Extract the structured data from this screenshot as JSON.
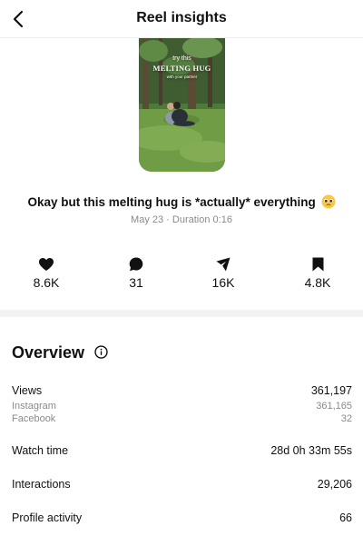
{
  "header": {
    "title": "Reel insights",
    "back_icon": "chevron-left-icon"
  },
  "reel": {
    "thumbnail_text": {
      "line1": "try this",
      "line2": "MELTING HUG",
      "line3": "with your partner"
    },
    "caption": "Okay but this melting hug is *actually* everything",
    "caption_emoji": "pleading-face-emoji",
    "meta": "May 23 · Duration 0:16"
  },
  "stats": [
    {
      "icon": "heart-icon",
      "value": "8.6K"
    },
    {
      "icon": "comment-icon",
      "value": "31"
    },
    {
      "icon": "send-icon",
      "value": "16K"
    },
    {
      "icon": "bookmark-icon",
      "value": "4.8K"
    }
  ],
  "overview": {
    "title": "Overview",
    "info_icon": "info-icon",
    "views": {
      "label": "Views",
      "value": "361,197"
    },
    "instagram": {
      "label": "Instagram",
      "value": "361,165"
    },
    "facebook": {
      "label": "Facebook",
      "value": "32"
    },
    "watch_time": {
      "label": "Watch time",
      "value": "28d 0h 33m 55s"
    },
    "interactions": {
      "label": "Interactions",
      "value": "29,206"
    },
    "profile_activity": {
      "label": "Profile activity",
      "value": "66"
    }
  },
  "colors": {
    "text": "#111111",
    "secondary_text": "#8a8a8a",
    "divider": "#f2f2f2",
    "background": "#ffffff"
  }
}
